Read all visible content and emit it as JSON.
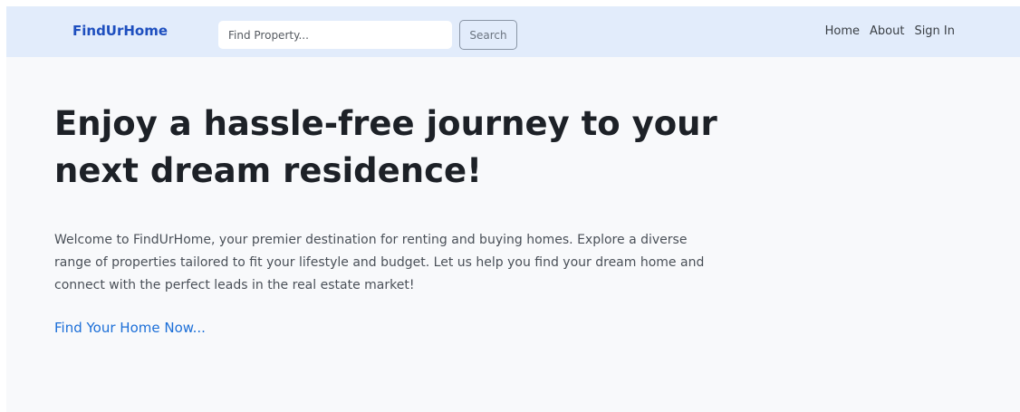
{
  "navbar": {
    "brand": "FindUrHome",
    "search": {
      "placeholder": "Find Property...",
      "value": ""
    },
    "search_button_label": "Search",
    "links": [
      "Home",
      "About",
      "Sign In"
    ]
  },
  "hero": {
    "title": "Enjoy a hassle-free journey to your next dream residence!",
    "description": "Welcome to FindUrHome, your premier destination for renting and buying homes. Explore a diverse range of properties tailored to fit your lifestyle and budget. Let us help you find your dream home and connect with the perfect leads in the real estate market!",
    "cta_label": "Find Your Home Now..."
  },
  "colors": {
    "navbar_bg": "#e2ecfb",
    "brand": "#1e4fbf",
    "page_bg": "#f8f9fb",
    "link_accent": "#1c6fd8",
    "title_text": "#1d2127"
  }
}
